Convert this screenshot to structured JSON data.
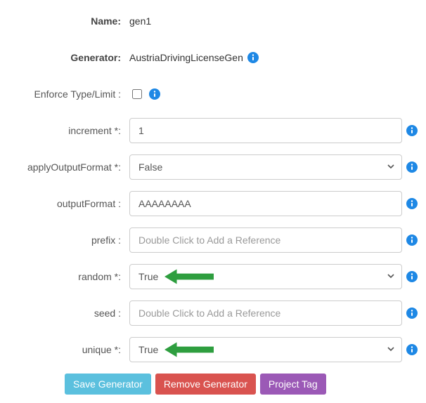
{
  "labels": {
    "name": "Name:",
    "generator": "Generator:",
    "enforce": "Enforce Type/Limit :",
    "increment": "increment *:",
    "applyOutputFormat": "applyOutputFormat *:",
    "outputFormat": "outputFormat :",
    "prefix": "prefix :",
    "random": "random *:",
    "seed": "seed :",
    "unique": "unique *:"
  },
  "values": {
    "name": "gen1",
    "generator": "AustriaDrivingLicenseGen",
    "increment": "1",
    "applyOutputFormat": "False",
    "outputFormat": "AAAAAAAA",
    "random": "True",
    "unique": "True"
  },
  "placeholders": {
    "prefix": "Double Click to Add a Reference",
    "seed": "Double Click to Add a Reference"
  },
  "buttons": {
    "save": "Save Generator",
    "remove": "Remove Generator",
    "projectTag": "Project Tag"
  },
  "colors": {
    "info_icon": "#1e88e5",
    "arrow": "#2e9e3f"
  }
}
